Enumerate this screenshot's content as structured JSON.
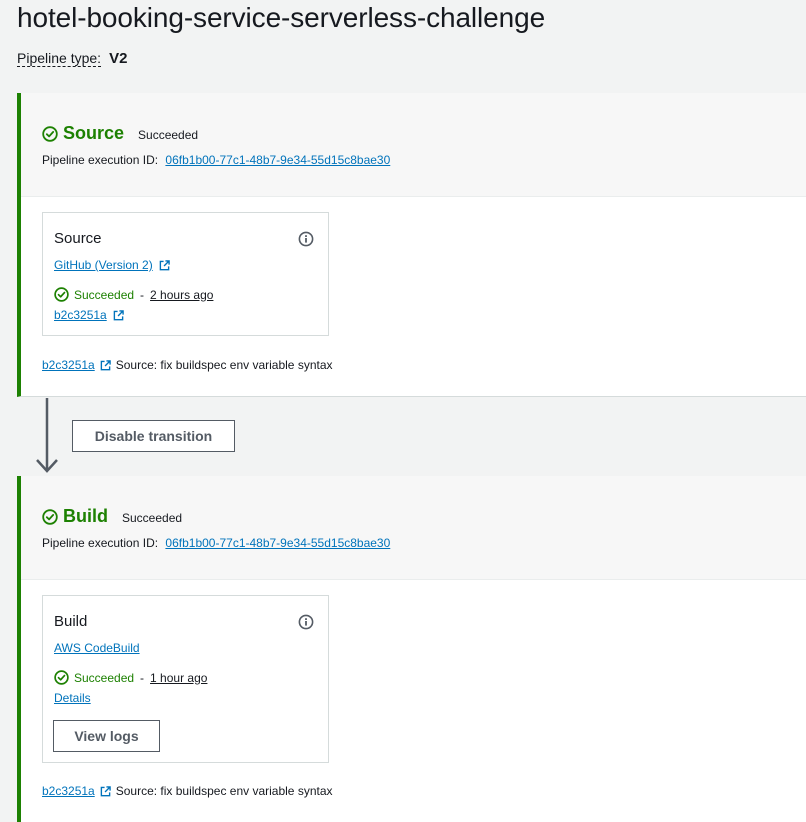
{
  "page": {
    "title": "hotel-booking-service-serverless-challenge",
    "pipeline_type_label": "Pipeline type:",
    "pipeline_type_value": "V2"
  },
  "colors": {
    "success": "#1d8102",
    "link": "#0073bb",
    "stage_border": "#1d8102",
    "background": "#f2f3f3"
  },
  "stages": [
    {
      "name": "Source",
      "status": "Succeeded",
      "exec_label": "Pipeline execution ID:",
      "exec_id": "06fb1b00-77c1-48b7-9e34-55d15c8bae30",
      "action": {
        "title": "Source",
        "provider": "GitHub (Version 2)",
        "status": "Succeeded",
        "separator": "-",
        "time": "2 hours ago",
        "commit": "b2c3251a"
      },
      "footer_commit": "b2c3251a",
      "footer_message": "Source: fix buildspec env variable syntax"
    },
    {
      "name": "Build",
      "status": "Succeeded",
      "exec_label": "Pipeline execution ID:",
      "exec_id": "06fb1b00-77c1-48b7-9e34-55d15c8bae30",
      "action": {
        "title": "Build",
        "provider": "AWS CodeBuild",
        "status": "Succeeded",
        "separator": "-",
        "time": "1 hour ago",
        "details": "Details",
        "view_logs": "View logs"
      },
      "footer_commit": "b2c3251a",
      "footer_message": "Source: fix buildspec env variable syntax"
    }
  ],
  "transition": {
    "button_label": "Disable transition"
  },
  "icons": {
    "success": "check-circle-icon",
    "info": "info-icon",
    "external": "external-link-icon",
    "transition": "down-arrow-icon"
  }
}
